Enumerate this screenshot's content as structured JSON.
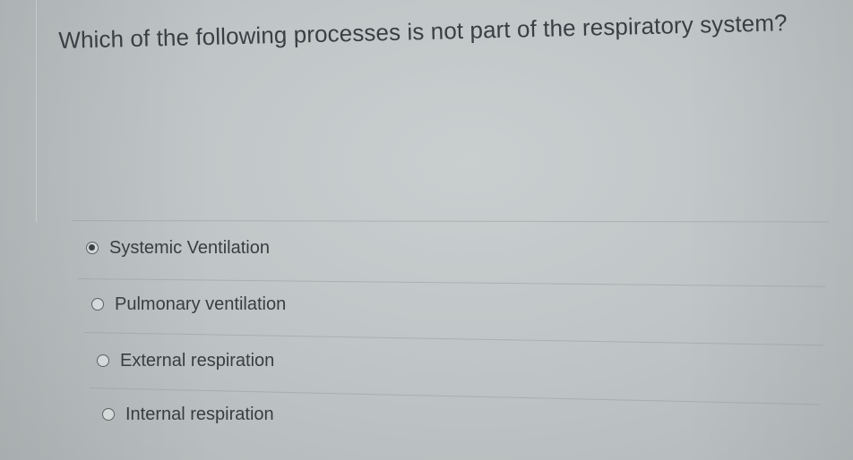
{
  "question": {
    "text": "Which of the following processes is not part of the respiratory system?"
  },
  "answers": {
    "selected_index": 0,
    "options": [
      {
        "label": "Systemic Ventilation",
        "selected": true
      },
      {
        "label": "Pulmonary ventilation",
        "selected": false
      },
      {
        "label": "External respiration",
        "selected": false
      },
      {
        "label": "Internal respiration",
        "selected": false
      }
    ]
  }
}
